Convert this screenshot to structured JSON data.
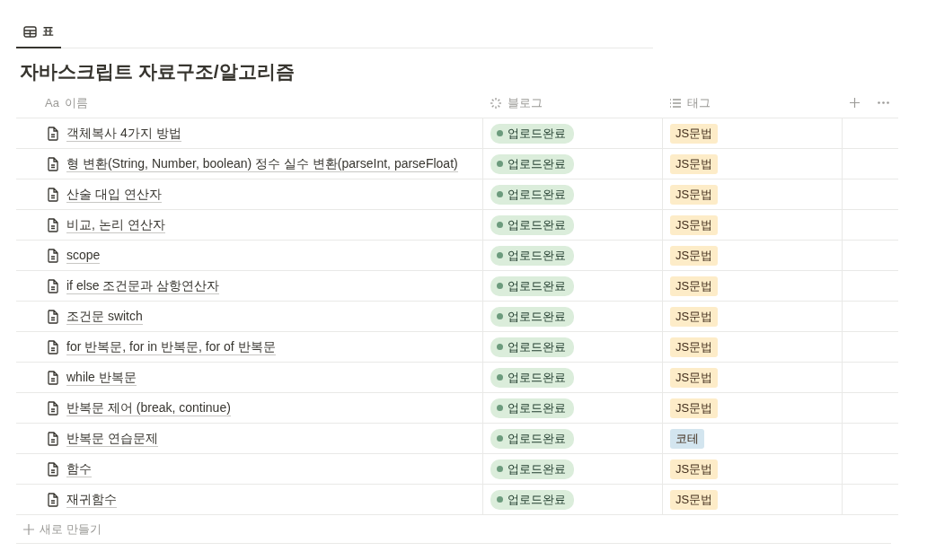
{
  "tabs": [
    {
      "label": "표",
      "selected": true
    }
  ],
  "title": "자바스크립트 자료구조/알고리즘",
  "table": {
    "columns": [
      {
        "label": "Aa",
        "name": "이름",
        "kind": "title"
      },
      {
        "name": "블로그",
        "kind": "status"
      },
      {
        "name": "태그",
        "kind": "tags"
      }
    ],
    "rows": [
      {
        "name": "객체복사 4가지 방법",
        "status": "업로드완료",
        "tag": {
          "label": "JS문법",
          "color": "#fdecc8"
        }
      },
      {
        "name": "형 변환(String, Number, boolean) 정수 실수 변환(parseInt, parseFloat)",
        "status": "업로드완료",
        "tag": {
          "label": "JS문법",
          "color": "#fdecc8"
        }
      },
      {
        "name": "산술 대입 연산자",
        "status": "업로드완료",
        "tag": {
          "label": "JS문법",
          "color": "#fdecc8"
        }
      },
      {
        "name": "비교, 논리 연산자",
        "status": "업로드완료",
        "tag": {
          "label": "JS문법",
          "color": "#fdecc8"
        }
      },
      {
        "name": "scope",
        "status": "업로드완료",
        "tag": {
          "label": "JS문법",
          "color": "#fdecc8"
        }
      },
      {
        "name": "if else 조건문과 삼항연산자",
        "status": "업로드완료",
        "tag": {
          "label": "JS문법",
          "color": "#fdecc8"
        }
      },
      {
        "name": "조건문 switch",
        "status": "업로드완료",
        "tag": {
          "label": "JS문법",
          "color": "#fdecc8"
        }
      },
      {
        "name": "for 반복문, for in 반복문, for of 반복문",
        "status": "업로드완료",
        "tag": {
          "label": "JS문법",
          "color": "#fdecc8"
        }
      },
      {
        "name": "while 반복문",
        "status": "업로드완료",
        "tag": {
          "label": "JS문법",
          "color": "#fdecc8"
        }
      },
      {
        "name": "반복문 제어 (break, continue)",
        "status": "업로드완료",
        "tag": {
          "label": "JS문법",
          "color": "#fdecc8"
        }
      },
      {
        "name": "반복문 연습문제",
        "status": "업로드완료",
        "tag": {
          "label": "코테",
          "color": "#d3e5ef"
        }
      },
      {
        "name": "함수",
        "status": "업로드완료",
        "tag": {
          "label": "JS문법",
          "color": "#fdecc8"
        }
      },
      {
        "name": "재귀함수",
        "status": "업로드완료",
        "tag": {
          "label": "JS문법",
          "color": "#fdecc8"
        }
      }
    ],
    "new_row": "새로 만들기"
  }
}
